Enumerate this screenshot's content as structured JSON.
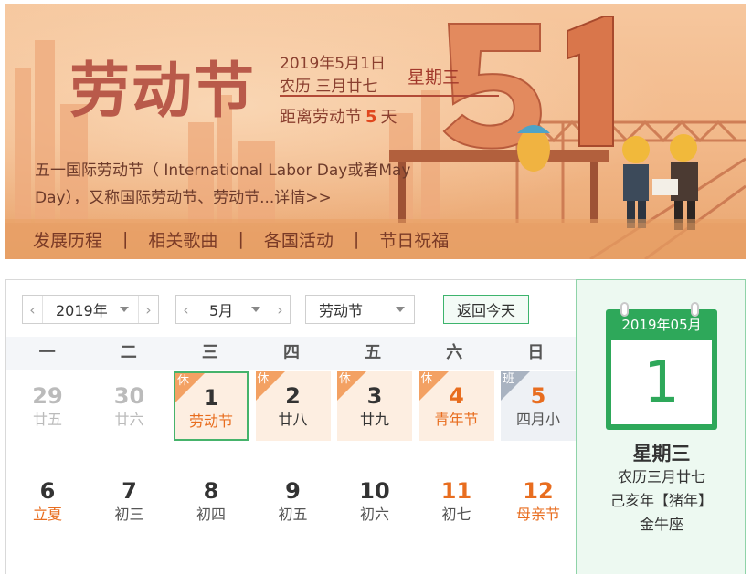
{
  "banner": {
    "title": "劳动节",
    "date": "2019年5月1日",
    "lunar": "农历 三月廿七",
    "weekday": "星期三",
    "countdown_prefix": "距离劳动节",
    "countdown_days": "5",
    "countdown_suffix": "天",
    "description": "五一国际劳动节（ International Labor Day或者May Day），又称国际劳动节、劳动节...详情>>",
    "nav": [
      "发展历程",
      "相关歌曲",
      "各国活动",
      "节日祝福"
    ],
    "separator": "|"
  },
  "controls": {
    "year": "2019年",
    "month": "5月",
    "holiday": "劳动节",
    "today_button": "返回今天",
    "prev_glyph": "‹",
    "next_glyph": "›"
  },
  "weekdays": [
    "一",
    "二",
    "三",
    "四",
    "五",
    "六",
    "日"
  ],
  "weeks": [
    [
      {
        "d": "29",
        "s": "廿五",
        "other": true
      },
      {
        "d": "30",
        "s": "廿六",
        "other": true
      },
      {
        "d": "1",
        "s": "劳动节",
        "tag": "休",
        "rest": true,
        "selected": true,
        "sub_orange": true
      },
      {
        "d": "2",
        "s": "廿八",
        "tag": "休",
        "rest": true
      },
      {
        "d": "3",
        "s": "廿九",
        "tag": "休",
        "rest": true
      },
      {
        "d": "4",
        "s": "青年节",
        "tag": "休",
        "rest": true,
        "orange": true,
        "sub_orange": true
      },
      {
        "d": "5",
        "s": "四月小",
        "tag": "班",
        "work": true,
        "orange": true
      }
    ],
    [
      {
        "d": "6",
        "s": "立夏",
        "sub_orange": true
      },
      {
        "d": "7",
        "s": "初三"
      },
      {
        "d": "8",
        "s": "初四"
      },
      {
        "d": "9",
        "s": "初五"
      },
      {
        "d": "10",
        "s": "初六"
      },
      {
        "d": "11",
        "s": "初七",
        "orange": true
      },
      {
        "d": "12",
        "s": "母亲节",
        "orange": true,
        "sub_orange": true
      }
    ]
  ],
  "side": {
    "month_label": "2019年05月",
    "day": "1",
    "weekday": "星期三",
    "lunar": "农历三月廿七",
    "ganzhi": "己亥年【猪年】",
    "zodiac": "金牛座"
  },
  "colors": {
    "accent_green": "#2ea85a",
    "holiday_orange": "#e86d1f",
    "rest_bg": "#fdeee1"
  }
}
